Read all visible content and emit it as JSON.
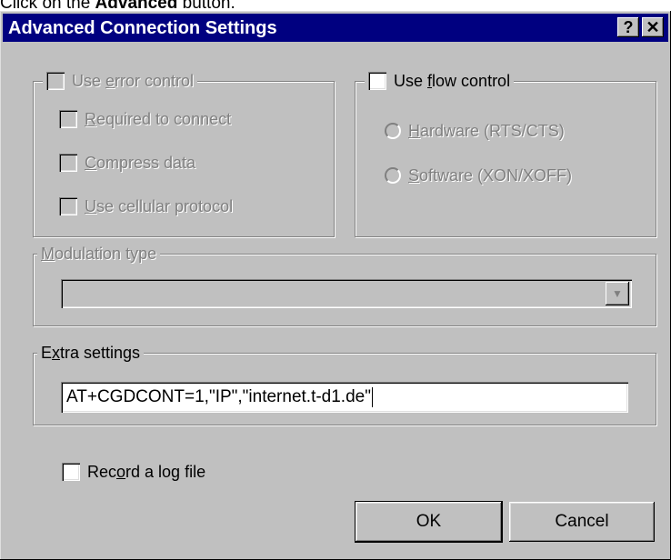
{
  "caption": {
    "prefix": "Click on the ",
    "bold": "Advanced",
    "suffix": " button."
  },
  "window": {
    "title": "Advanced Connection Settings",
    "help_label": "?",
    "close_label": "✕"
  },
  "error_control": {
    "label": {
      "before": "Use ",
      "accel": "e",
      "after": "rror control"
    },
    "enabled": false,
    "options": [
      {
        "accel": "R",
        "after": "equired to connect",
        "checked": false
      },
      {
        "accel": "C",
        "after": "ompress data",
        "checked": false
      },
      {
        "accel": "U",
        "after": "se cellular protocol",
        "checked": false
      }
    ]
  },
  "flow_control": {
    "label": {
      "before": "Use ",
      "accel": "f",
      "after": "low control"
    },
    "checked": false,
    "options": [
      {
        "accel": "H",
        "after": "ardware (RTS/CTS)"
      },
      {
        "accel": "S",
        "after": "oftware (XON/XOFF)"
      }
    ]
  },
  "modulation": {
    "label": {
      "accel": "M",
      "after": "odulation type"
    },
    "value": "",
    "enabled": false
  },
  "extra_settings": {
    "label": {
      "before": "E",
      "accel": "x",
      "after": "tra settings"
    },
    "value": "AT+CGDCONT=1,\"IP\",\"internet.t-d1.de\""
  },
  "log_file": {
    "label": {
      "before": "Rec",
      "accel": "o",
      "after": "rd a log file"
    },
    "checked": false
  },
  "buttons": {
    "ok": "OK",
    "cancel": "Cancel"
  }
}
